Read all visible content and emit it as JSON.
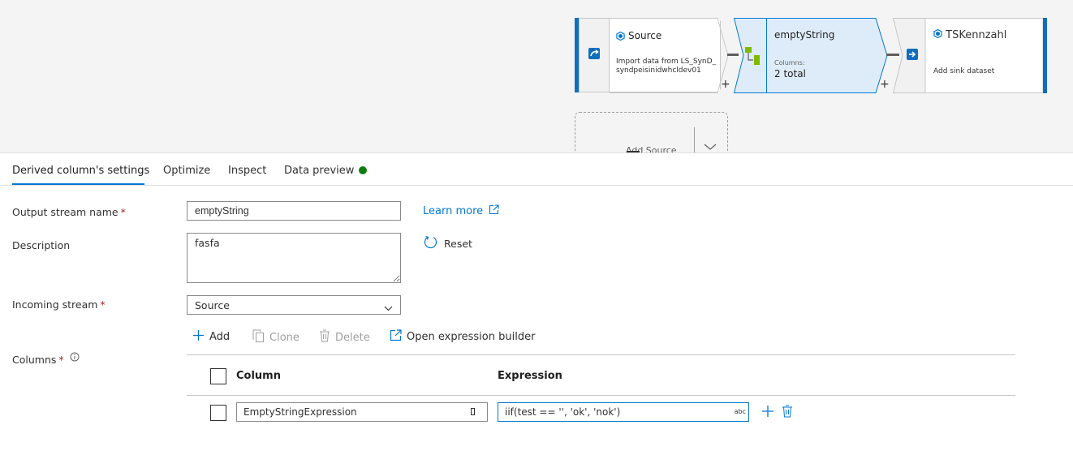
{
  "canvas": {
    "nodes": [
      {
        "title": "Source",
        "subtitle": "Import data from LS_SynD_syndpeisinidwhcldev01"
      },
      {
        "title": "emptyString",
        "columns_label": "Columns:",
        "columns_value": "2 total"
      },
      {
        "title": "TSKennzahl",
        "subtitle": "Add sink dataset"
      }
    ],
    "plus_label": "+",
    "add_source_label": "Add Source"
  },
  "tabs": [
    {
      "label": "Derived column's settings",
      "active": true
    },
    {
      "label": "Optimize"
    },
    {
      "label": "Inspect"
    },
    {
      "label": "Data preview"
    }
  ],
  "form": {
    "output_stream_label": "Output stream name",
    "output_stream_value": "emptyString",
    "required_mark": "*",
    "learn_more": "Learn more",
    "description_label": "Description",
    "description_value": "fasfa",
    "reset": "Reset",
    "incoming_stream_label": "Incoming stream",
    "incoming_stream_value": "Source",
    "columns_label": "Columns"
  },
  "toolbar": {
    "add": "Add",
    "clone": "Clone",
    "delete": "Delete",
    "open_builder": "Open expression builder"
  },
  "table": {
    "headers": {
      "column": "Column",
      "expression": "Expression"
    },
    "rows": [
      {
        "column": "EmptyStringExpression",
        "expression": "iif(test == '', 'ok', 'nok')",
        "type_badge": "abc"
      }
    ]
  },
  "colors": {
    "accent": "#0078d4",
    "selected_node_bg": "#deecf9",
    "status_green": "#107c10",
    "required": "#a4262c"
  }
}
